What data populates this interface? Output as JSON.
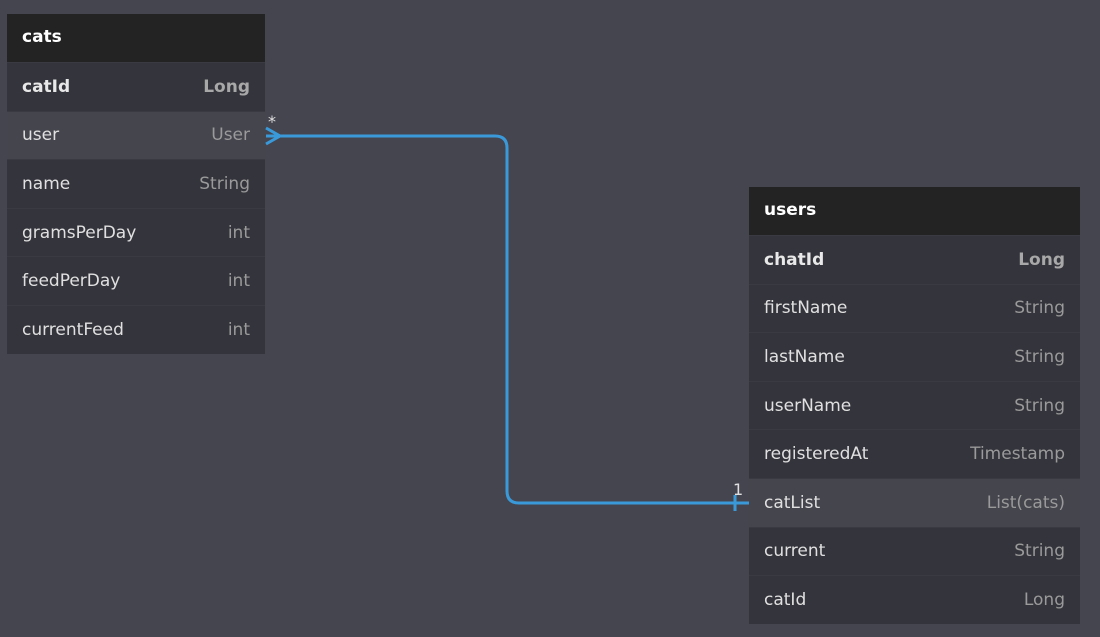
{
  "tables": [
    {
      "name": "cats",
      "fields": [
        {
          "name": "catId",
          "type": "Long",
          "pk": true
        },
        {
          "name": "user",
          "type": "User",
          "highlight": true
        },
        {
          "name": "name",
          "type": "String"
        },
        {
          "name": "gramsPerDay",
          "type": "int"
        },
        {
          "name": "feedPerDay",
          "type": "int"
        },
        {
          "name": "currentFeed",
          "type": "int"
        }
      ]
    },
    {
      "name": "users",
      "fields": [
        {
          "name": "chatId",
          "type": "Long",
          "pk": true
        },
        {
          "name": "firstName",
          "type": "String"
        },
        {
          "name": "lastName",
          "type": "String"
        },
        {
          "name": "userName",
          "type": "String"
        },
        {
          "name": "registeredAt",
          "type": "Timestamp"
        },
        {
          "name": "catList",
          "type": "List(cats)",
          "highlight": true
        },
        {
          "name": "current",
          "type": "String"
        },
        {
          "name": "catId",
          "type": "Long"
        }
      ]
    }
  ],
  "relationship": {
    "from": "cats.user",
    "to": "users.catList",
    "from_cardinality": "*",
    "to_cardinality": "1",
    "color": "#3a9ad9"
  }
}
